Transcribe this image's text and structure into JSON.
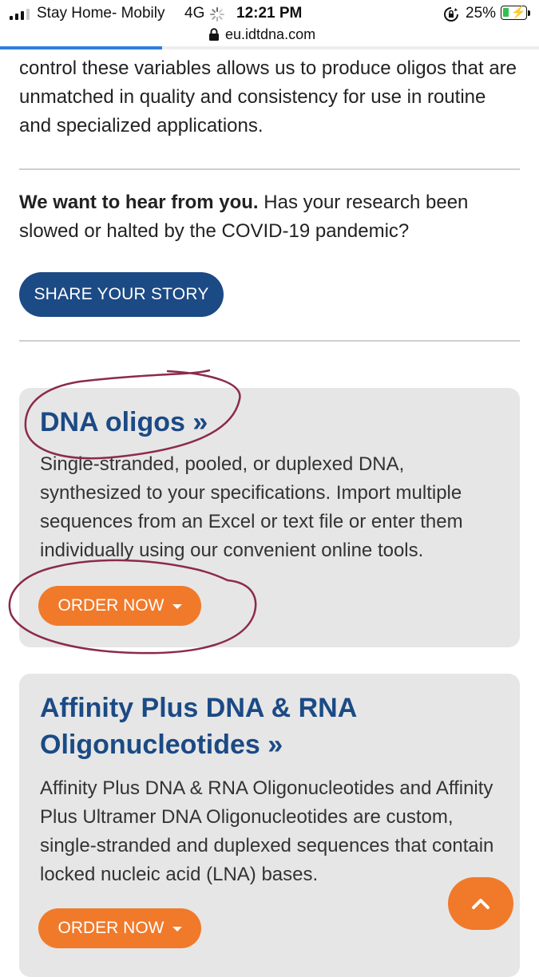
{
  "status_bar": {
    "carrier": "Stay Home- Mobily",
    "network": "4G",
    "time": "12:21 PM",
    "battery": "25%"
  },
  "browser": {
    "url": "eu.idtdna.com",
    "load_progress": 0.3
  },
  "intro_text": "control these variables allows us to produce oligos that are unmatched in quality and consistency for use in routine and specialized applications.",
  "feedback": {
    "bold": "We want to hear from you.",
    "text": " Has your research been slowed or halted by the COVID-19 pandemic?",
    "button": "SHARE YOUR STORY"
  },
  "cards": [
    {
      "title": "DNA oligos »",
      "description": "Single-stranded, pooled, or duplexed DNA, synthesized to your specifications. Import multiple sequences from an Excel or text file or enter them individually using our convenient online tools.",
      "button": "ORDER NOW"
    },
    {
      "title": "Affinity Plus DNA & RNA Oligonucleotides »",
      "description": "Affinity Plus DNA & RNA Oligonucleotides and Affinity Plus Ultramer DNA Oligonucleotides are custom, single-stranded and duplexed sequences that contain locked nucleic acid (LNA) bases.",
      "button": "ORDER NOW"
    }
  ],
  "icons": {
    "signal": "signal-bars-icon",
    "loading": "loading-spinner-icon",
    "orientation_lock": "orientation-lock-icon",
    "battery": "battery-charging-icon",
    "lock": "lock-icon",
    "dropdown": "caret-down-icon",
    "back_to_top": "chevron-up-icon"
  },
  "colors": {
    "brand_blue": "#1b4a85",
    "order_orange": "#f07a2a",
    "card_bg": "#e6e6e6",
    "annotation": "#8b2a4e"
  }
}
